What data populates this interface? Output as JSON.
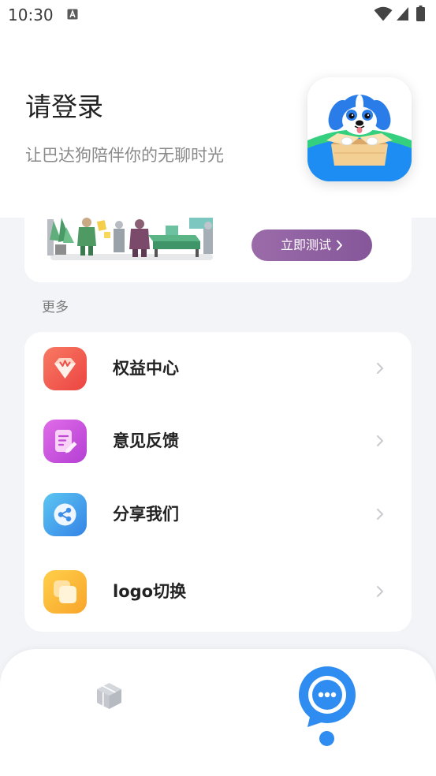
{
  "status_bar": {
    "time": "10:30",
    "notification_icon": "a-letter-icon",
    "wifi_icon": "wifi-icon",
    "signal_icon": "signal-icon",
    "battery_icon": "battery-icon"
  },
  "header": {
    "title": "请登录",
    "subtitle": "让巴达狗陪伴你的无聊时光",
    "app_icon": "dog-in-box-icon"
  },
  "promo": {
    "illustration": "office-people-illustration",
    "button_label": "立即测试",
    "button_icon": "chevron-right-icon",
    "button_color": "#8d5f9f"
  },
  "more": {
    "section_label": "更多",
    "items": [
      {
        "label": "权益中心",
        "icon": "diamond-crown-icon",
        "color": "#f1544b"
      },
      {
        "label": "意见反馈",
        "icon": "edit-document-icon",
        "color": "#c94ad9"
      },
      {
        "label": "分享我们",
        "icon": "share-icon",
        "color": "#3f9bec"
      },
      {
        "label": "logo切换",
        "icon": "switch-layers-icon",
        "color": "#fbb133"
      }
    ],
    "chevron_icon": "chevron-right-icon"
  },
  "bottom_nav": {
    "tabs": [
      {
        "icon": "cube-icon",
        "active": false
      },
      {
        "icon": "chat-bubble-icon",
        "active": true
      }
    ],
    "accent_color": "#2f8cf0",
    "inactive_color": "#c4c8ce"
  },
  "colors": {
    "background": "#f3f4f8",
    "card": "#ffffff",
    "text_primary": "#222222",
    "text_secondary": "#8a8a8a"
  }
}
